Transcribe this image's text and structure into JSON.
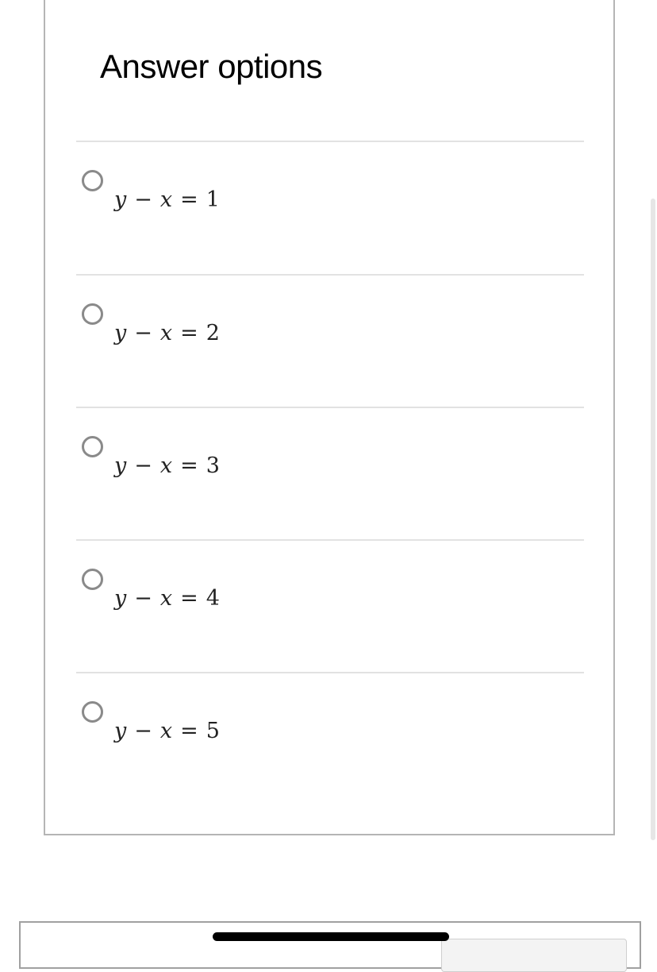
{
  "section": {
    "title": "Answer options"
  },
  "options": [
    {
      "lhs_a": "y",
      "op1": "−",
      "lhs_b": "x",
      "op2": "=",
      "rhs": "1",
      "selected": false
    },
    {
      "lhs_a": "y",
      "op1": "−",
      "lhs_b": "x",
      "op2": "=",
      "rhs": "2",
      "selected": false
    },
    {
      "lhs_a": "y",
      "op1": "−",
      "lhs_b": "x",
      "op2": "=",
      "rhs": "3",
      "selected": false
    },
    {
      "lhs_a": "y",
      "op1": "−",
      "lhs_b": "x",
      "op2": "=",
      "rhs": "4",
      "selected": false
    },
    {
      "lhs_a": "y",
      "op1": "−",
      "lhs_b": "x",
      "op2": "=",
      "rhs": "5",
      "selected": false
    }
  ],
  "icons": {
    "radio": "radio-unchecked-icon"
  },
  "colors": {
    "radio_border": "#8a8a8a",
    "divider": "#e2e2e2",
    "card_border": "#b5b5b5"
  }
}
